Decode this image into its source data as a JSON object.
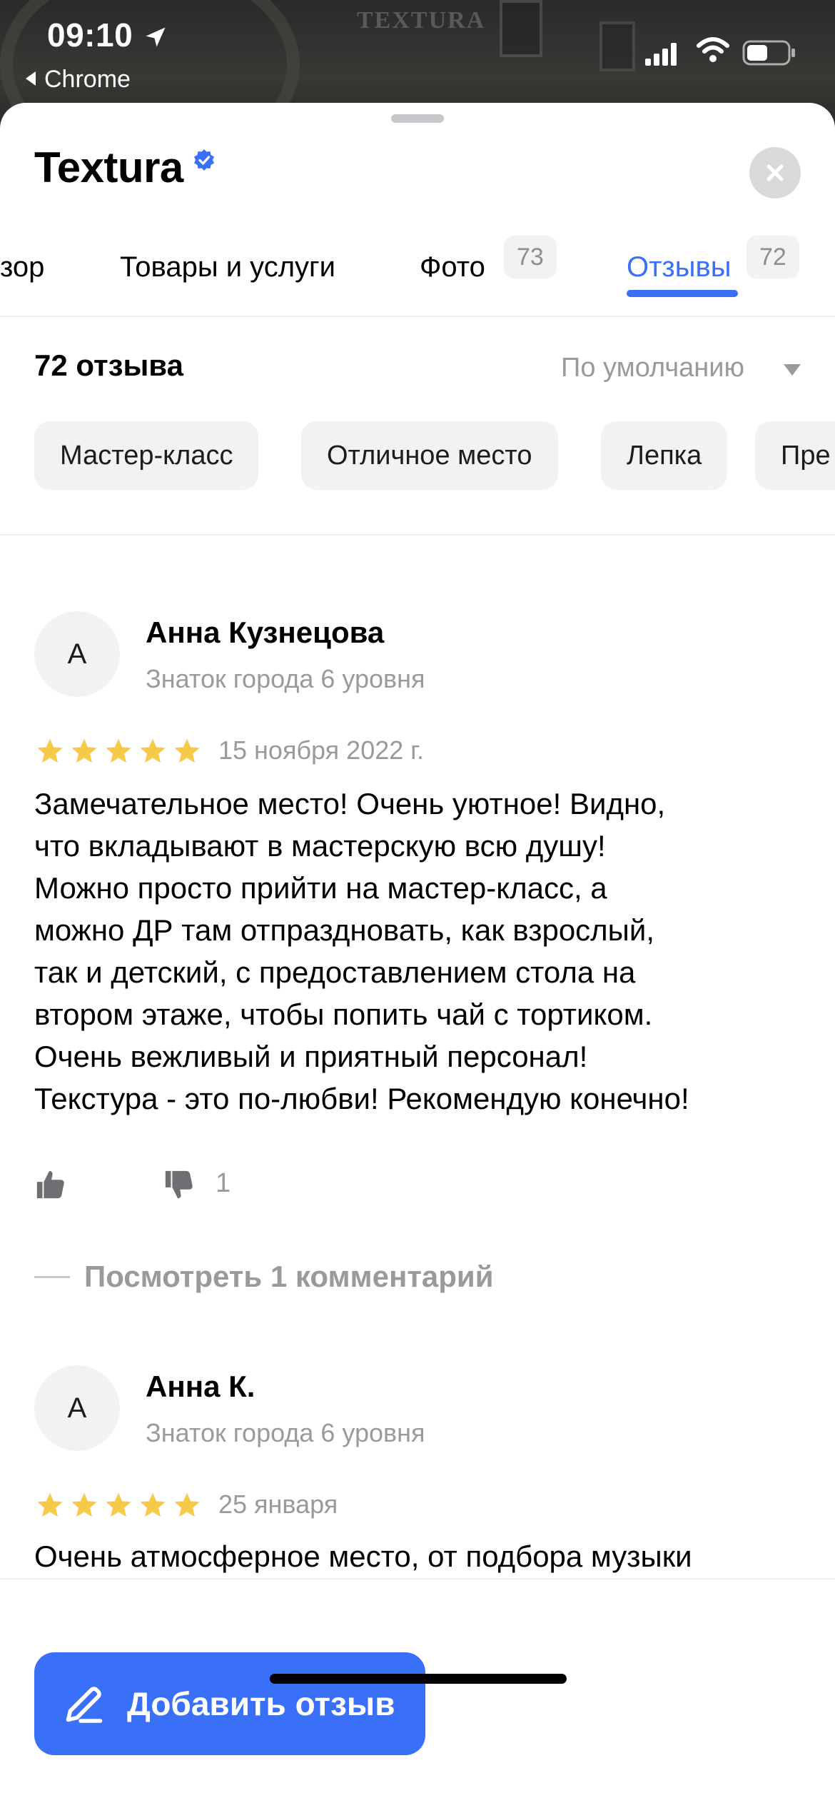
{
  "status_bar": {
    "time": "09:10",
    "back_app": "Chrome",
    "icons": [
      "location-arrow-icon",
      "cellular-signal-icon",
      "wifi-icon",
      "battery-icon"
    ]
  },
  "header": {
    "title": "Textura",
    "verified_icon": "verified-badge-icon",
    "close_icon": "close-icon"
  },
  "tabs": [
    {
      "label": "зор"
    },
    {
      "label": "Товары и услуги"
    },
    {
      "label": "Фото",
      "count": "73"
    },
    {
      "label": "Отзывы",
      "count": "72",
      "active": true
    }
  ],
  "reviews_header": {
    "count_label": "72 отзыва",
    "sort_label": "По умолчанию"
  },
  "chips": [
    "Мастер-класс",
    "Отличное место",
    "Лепка",
    "Пре"
  ],
  "reviews": [
    {
      "avatar": "А",
      "name": "Анна Кузнецова",
      "level": "Знаток города 6 уровня",
      "rating": 5,
      "date": "15 ноября 2022 г.",
      "text_lines": [
        "Замечательное место! Очень уютное! Видно,",
        "что вкладывают в мастерскую всю душу!",
        "Можно просто прийти на мастер-класс, а",
        "можно ДР там отпраздновать, как взрослый,",
        "так и детский, с предоставлением стола на",
        "втором этаже, чтобы попить чай с тортиком.",
        "Очень вежливый и приятный персонал!",
        "Текстура - это по-любви! Рекомендую конечно!"
      ],
      "dislikes": "1",
      "comments_link": "Посмотреть 1 комментарий"
    },
    {
      "avatar": "А",
      "name": "Анна К.",
      "level": "Знаток города 6 уровня",
      "rating": 5,
      "date": "25 января",
      "text_lines": [
        "Очень атмосферное место, от подбора музыки"
      ]
    }
  ],
  "add_review_button": {
    "label": "Добавить отзыв",
    "icon": "pencil-icon"
  },
  "colors": {
    "accent": "#3a6ff7",
    "star": "#f7c948",
    "muted": "#9a9a9e"
  }
}
